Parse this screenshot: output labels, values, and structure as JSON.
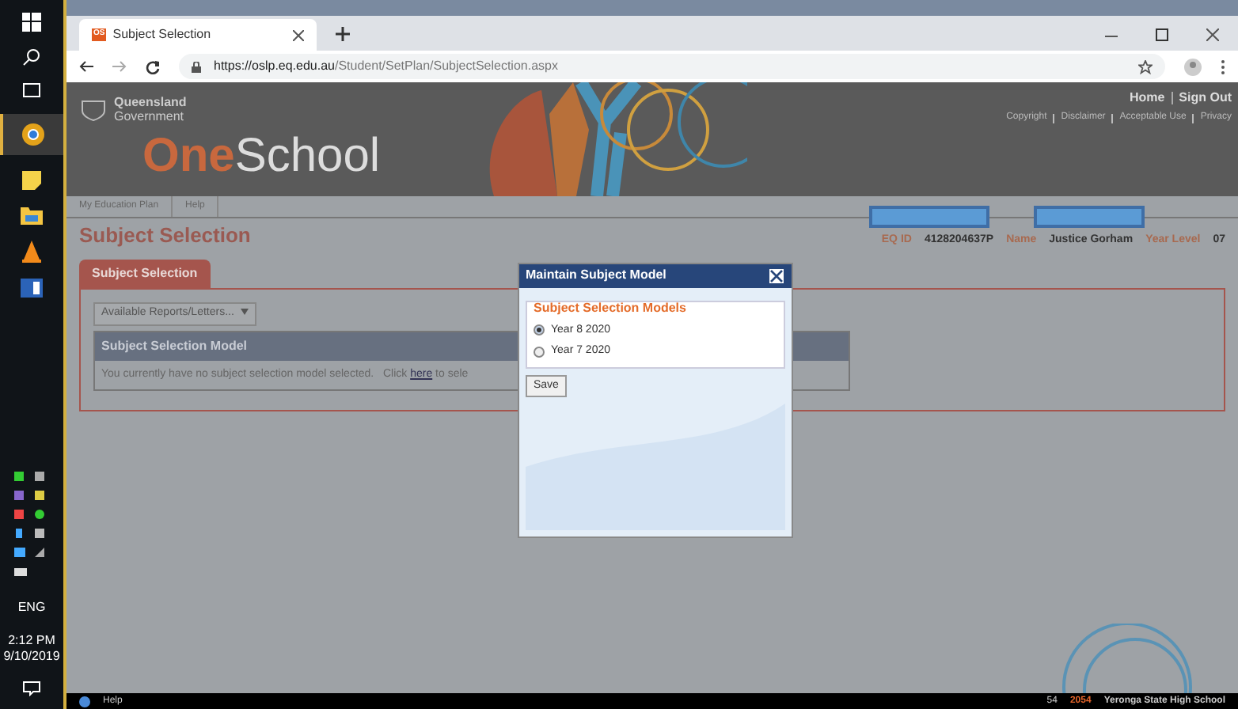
{
  "taskbar": {
    "tray_language": "ENG",
    "time": "2:12 PM",
    "date": "9/10/2019"
  },
  "browser": {
    "tab_title": "Subject Selection",
    "tab_favicon": "OS",
    "url_host": "https://oslp.eq.edu.au",
    "url_path": "/Student/SetPlan/SubjectSelection.aspx"
  },
  "header": {
    "brand_line1": "Queensland",
    "brand_line2": "Government",
    "logo_part1": "One",
    "logo_part2": "School",
    "top_links": [
      "Home",
      "Sign Out"
    ],
    "sub_links": [
      "Copyright",
      "Disclaimer",
      "Acceptable Use",
      "Privacy"
    ]
  },
  "nav": [
    "My Education Plan",
    "Help"
  ],
  "page_title": "Subject Selection",
  "student": [
    {
      "label": "EQ ID",
      "value": "4128204637P"
    },
    {
      "label": "Name",
      "value": "Justice Gorham"
    },
    {
      "label": "Year Level",
      "value": "07"
    }
  ],
  "tabs": [
    {
      "label": "Subject Selection",
      "selected": true
    }
  ],
  "reports_dropdown": "Available Reports/Letters...",
  "panel": {
    "title": "Subject Selection Model",
    "message_before": "You currently have no subject selection model selected.   Click ",
    "link": "here",
    "message_after": " to sele"
  },
  "modal": {
    "title": "Maintain Subject Model",
    "legend": "Subject Selection Models",
    "options": [
      {
        "label": "Year 8 2020",
        "selected": true
      },
      {
        "label": "Year 7 2020",
        "selected": false
      }
    ],
    "button": "Save"
  },
  "status_bar": {
    "help": "Help",
    "count": "54",
    "school_code": "2054",
    "school_name": "Yeronga State High School"
  }
}
